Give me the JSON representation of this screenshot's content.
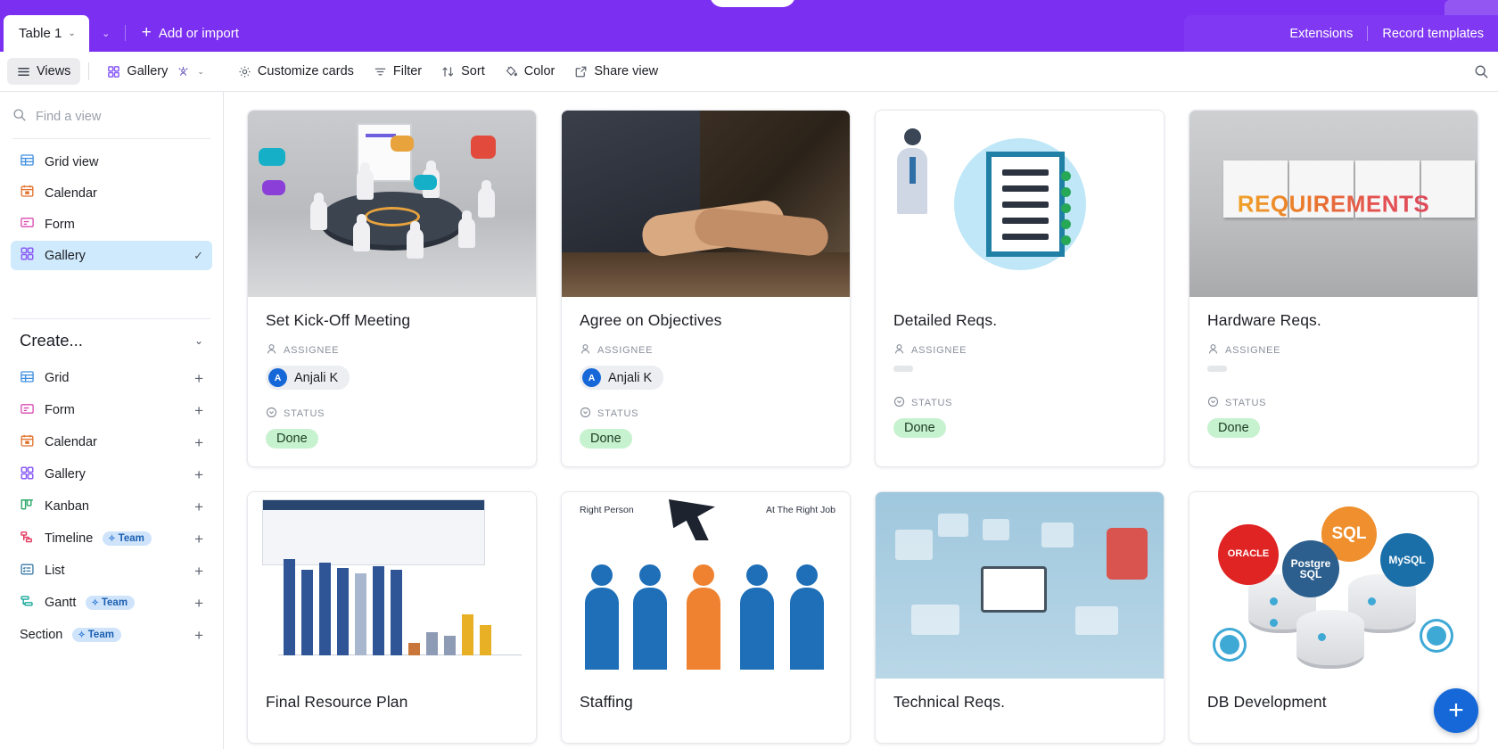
{
  "topbar": {
    "table_tab": "Table 1",
    "table_caret": "⌄",
    "tabs_chevron": "⌄",
    "add_import": "Add or import",
    "add_plus": "+",
    "extensions": "Extensions",
    "record_templates": "Record templates"
  },
  "viewbar": {
    "views_label": "Views",
    "views_icon": "hamburger-icon",
    "gallery_label": "Gallery",
    "gallery_icon": "gallery-grid-icon",
    "collaborators_icon": "people-icon",
    "gallery_chevron": "⌄",
    "customize_cards": "Customize cards",
    "customize_icon": "gear-icon",
    "filter": "Filter",
    "filter_icon": "funnel-icon",
    "sort": "Sort",
    "sort_icon": "sort-arrows-icon",
    "color": "Color",
    "color_icon": "paint-bucket-icon",
    "share_view": "Share view",
    "share_icon": "external-link-icon",
    "search_icon": "search-icon"
  },
  "sidebar": {
    "search": {
      "placeholder": "Find a view",
      "value": "",
      "icon": "search-icon"
    },
    "views": [
      {
        "label": "Grid view",
        "icon": "grid-icon",
        "active": false,
        "checked": false
      },
      {
        "label": "Calendar",
        "icon": "calendar-icon",
        "active": false,
        "checked": false
      },
      {
        "label": "Form",
        "icon": "form-icon",
        "active": false,
        "checked": false
      },
      {
        "label": "Gallery",
        "icon": "gallery-icon",
        "active": true,
        "checked": true
      }
    ],
    "check_glyph": "✓",
    "create_header": "Create...",
    "create_chevron": "⌄",
    "create_items": [
      {
        "label": "Grid",
        "icon": "grid-icon",
        "badge": ""
      },
      {
        "label": "Form",
        "icon": "form-icon",
        "badge": ""
      },
      {
        "label": "Calendar",
        "icon": "calendar-icon",
        "badge": ""
      },
      {
        "label": "Gallery",
        "icon": "gallery-icon",
        "badge": ""
      },
      {
        "label": "Kanban",
        "icon": "kanban-icon",
        "badge": ""
      },
      {
        "label": "Timeline",
        "icon": "timeline-icon",
        "badge": "Team"
      },
      {
        "label": "List",
        "icon": "list-icon",
        "badge": ""
      },
      {
        "label": "Gantt",
        "icon": "gantt-icon",
        "badge": "Team"
      },
      {
        "label": "Section",
        "icon": "",
        "badge": "Team"
      }
    ],
    "add_glyph": "+",
    "badge_spark": "✧"
  },
  "gallery": {
    "assignee_label": "Assignee",
    "status_label": "Status",
    "assignee_icon": "person-icon",
    "status_icon": "circle-chevron-down-icon",
    "add_record_glyph": "+",
    "cards": [
      {
        "title": "Set Kick-Off Meeting",
        "assignee": "Anjali K",
        "avatar_initial": "A",
        "status": "Done",
        "thumb": "meeting-illustration"
      },
      {
        "title": "Agree on Objectives",
        "assignee": "Anjali K",
        "avatar_initial": "A",
        "status": "Done",
        "thumb": "handshake-photo"
      },
      {
        "title": "Detailed Reqs.",
        "assignee": "",
        "avatar_initial": "",
        "status": "Done",
        "thumb": "checklist-illustration"
      },
      {
        "title": "Hardware Reqs.",
        "assignee": "",
        "avatar_initial": "",
        "status": "Done",
        "thumb": "requirements-puzzle"
      },
      {
        "title": "Final Resource Plan",
        "assignee": "",
        "avatar_initial": "",
        "status": "",
        "thumb": "resource-plan-chart"
      },
      {
        "title": "Staffing",
        "assignee": "",
        "avatar_initial": "",
        "status": "",
        "thumb": "staffing-people"
      },
      {
        "title": "Technical Reqs.",
        "assignee": "",
        "avatar_initial": "",
        "status": "",
        "thumb": "technology-illustration"
      },
      {
        "title": "DB Development",
        "assignee": "",
        "avatar_initial": "",
        "status": "",
        "thumb": "database-logos"
      }
    ],
    "thumb_text": {
      "requirements": "REQUIREMENTS",
      "staffing_left": "Right Person",
      "staffing_right": "At The Right Job",
      "db_oracle": "ORACLE",
      "db_sql": "SQL",
      "db_postgres": "Postgre\nSQL",
      "db_mysql": "MySQL"
    }
  },
  "colors": {
    "brand_purple": "#7b2ff0",
    "accent_blue": "#1668d8",
    "status_done_bg": "#c7f2cf",
    "active_view_bg": "#cfeafc",
    "team_badge_bg": "#cfe4fb"
  }
}
